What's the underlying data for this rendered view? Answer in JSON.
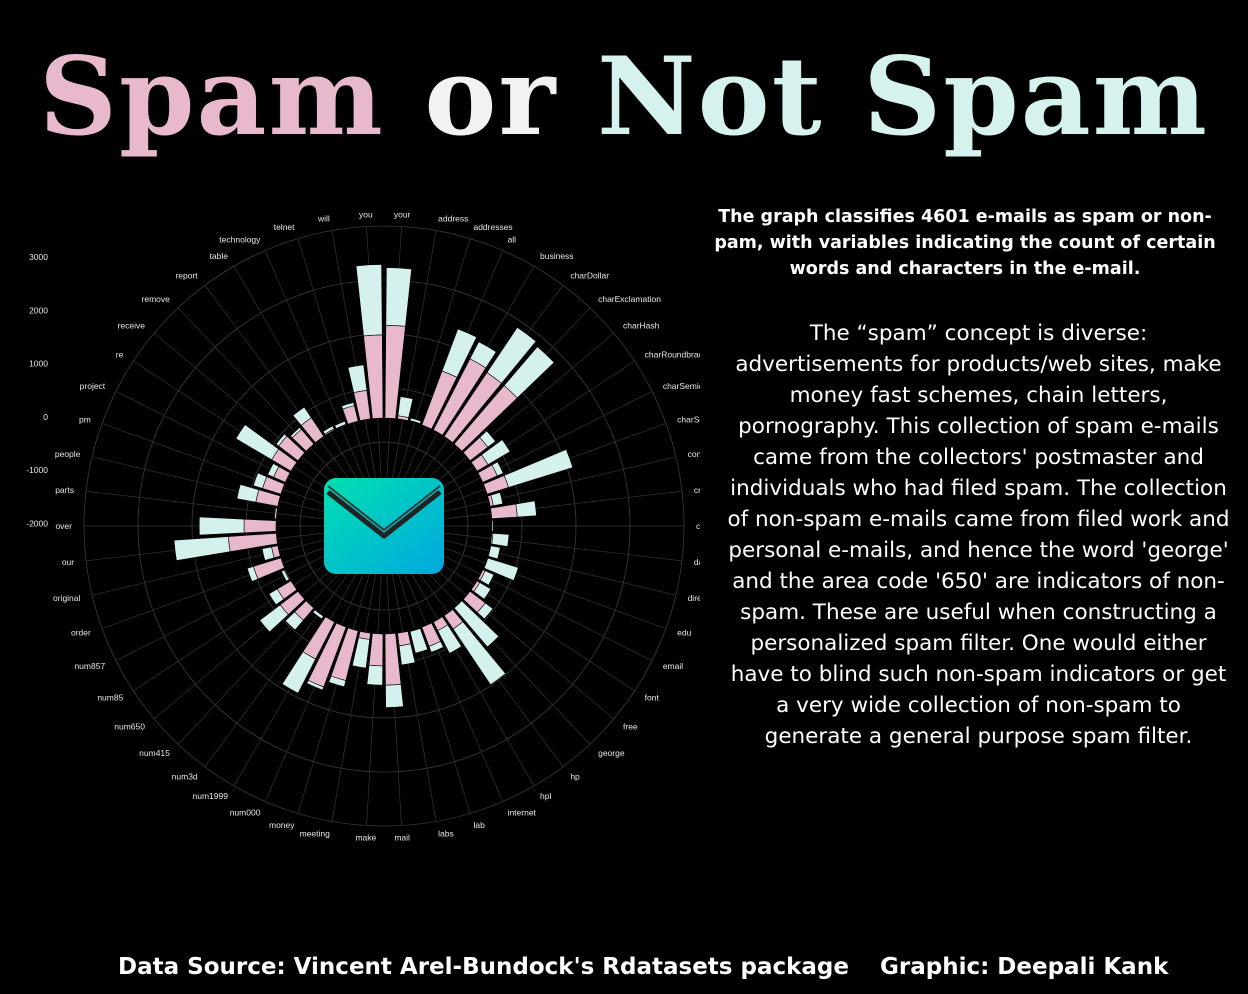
{
  "title": {
    "part1": "Spam",
    "part2": "or",
    "part3": "Not Spam"
  },
  "subtitle": "The graph classifies 4601 e-mails as spam or non-pam, with variables indicating the count of certain words and characters in the e-mail.",
  "description": "The “spam” concept is diverse: advertisements for products/web sites, make money fast schemes, chain letters, pornography. This collection of spam e-mails came from the collectors' postmaster and individuals who had filed spam. The collection of non-spam e-mails came from filed work and personal e-mails, and hence the word 'george' and the area code '650' are indicators of non-spam. These are useful when constructing a personalized spam filter. One would either have to blind such non-spam indicators or get a very wide collection of non-spam to generate a general purpose spam filter.",
  "footer": {
    "source": "Data Source: Vincent Arel-Bundock's Rdatasets package",
    "credit": "Graphic: Deepali Kank"
  },
  "colors": {
    "spam": "#e8b8cd",
    "not_spam": "#d4f1ee",
    "background": "#000000",
    "icon_gradient": [
      "#00e0b0",
      "#00a8e0"
    ]
  },
  "icon": "envelope-icon",
  "chart_data": {
    "type": "bar",
    "polar": true,
    "stacked": true,
    "ylim": [
      -2000,
      3000
    ],
    "yticks": [
      3000,
      2000,
      1000,
      0,
      -1000,
      -2000
    ],
    "grid": true,
    "categories": [
      "your",
      "address",
      "addresses",
      "all",
      "business",
      "charDollar",
      "charExclamation",
      "charHash",
      "charRoundbracket",
      "charSemicolon",
      "charSquarebracket",
      "conference",
      "credit",
      "cs",
      "data",
      "direct",
      "edu",
      "email",
      "font",
      "free",
      "george",
      "hp",
      "hpl",
      "internet",
      "lab",
      "labs",
      "mail",
      "make",
      "meeting",
      "money",
      "num000",
      "num1999",
      "num3d",
      "num415",
      "num650",
      "num85",
      "num857",
      "order",
      "original",
      "our",
      "over",
      "parts",
      "people",
      "pm",
      "project",
      "re",
      "receive",
      "remove",
      "report",
      "table",
      "technology",
      "telnet",
      "will",
      "you"
    ],
    "series": [
      {
        "values": [
          1450,
          50,
          10,
          900,
          1250,
          1200,
          1200,
          350,
          200,
          250,
          350,
          50,
          400,
          0,
          20,
          10,
          10,
          40,
          50,
          300,
          0,
          250,
          150,
          320,
          10,
          200,
          800,
          500,
          100,
          800,
          1000,
          650,
          10,
          250,
          350,
          250,
          15,
          450,
          100,
          750,
          500,
          30,
          350,
          300,
          200,
          350,
          380,
          300,
          350,
          20,
          10,
          250,
          450,
          1300
        ]
      },
      {
        "values": [
          900,
          300,
          40,
          700,
          300,
          850,
          800,
          150,
          400,
          100,
          1050,
          150,
          300,
          20,
          250,
          150,
          500,
          150,
          200,
          150,
          800,
          1050,
          400,
          100,
          350,
          300,
          350,
          300,
          450,
          100,
          50,
          600,
          50,
          200,
          400,
          150,
          50,
          100,
          150,
          850,
          700,
          10,
          300,
          150,
          100,
          650,
          50,
          40,
          200,
          50,
          50,
          50,
          400,
          1100
        ]
      }
    ]
  }
}
